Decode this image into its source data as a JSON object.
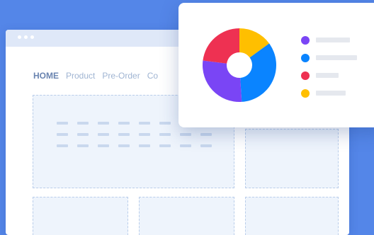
{
  "theme": {
    "background": "#5486e8",
    "window_bar": "#dfe8f8",
    "placeholder_border": "#b9cdea",
    "placeholder_fill": "#eef4fc",
    "nav_active": "#6a84b0",
    "nav_inactive": "#9fb4d2"
  },
  "browser": {
    "window_dots": [
      "dot",
      "dot",
      "dot"
    ],
    "nav": [
      {
        "label": "HOME",
        "active": true
      },
      {
        "label": "Product",
        "active": false
      },
      {
        "label": "Pre-Order",
        "active": false
      },
      {
        "label": "Co",
        "active": false
      }
    ],
    "placeholder_dash_grid": {
      "rows": 3,
      "cols": 8
    }
  },
  "chart_data": {
    "type": "pie",
    "variant": "donut",
    "series": [
      {
        "color": "#ffbf00",
        "value": 15
      },
      {
        "color": "#0a84ff",
        "value": 34
      },
      {
        "color": "#7a45f5",
        "value": 28
      },
      {
        "color": "#ee3152",
        "value": 23
      }
    ],
    "legend": [
      {
        "color": "#7a45f5",
        "icon": "legend-dot-purple"
      },
      {
        "color": "#0a84ff",
        "icon": "legend-dot-blue"
      },
      {
        "color": "#ee3152",
        "icon": "legend-dot-red"
      },
      {
        "color": "#ffbf00",
        "icon": "legend-dot-yellow"
      }
    ]
  }
}
